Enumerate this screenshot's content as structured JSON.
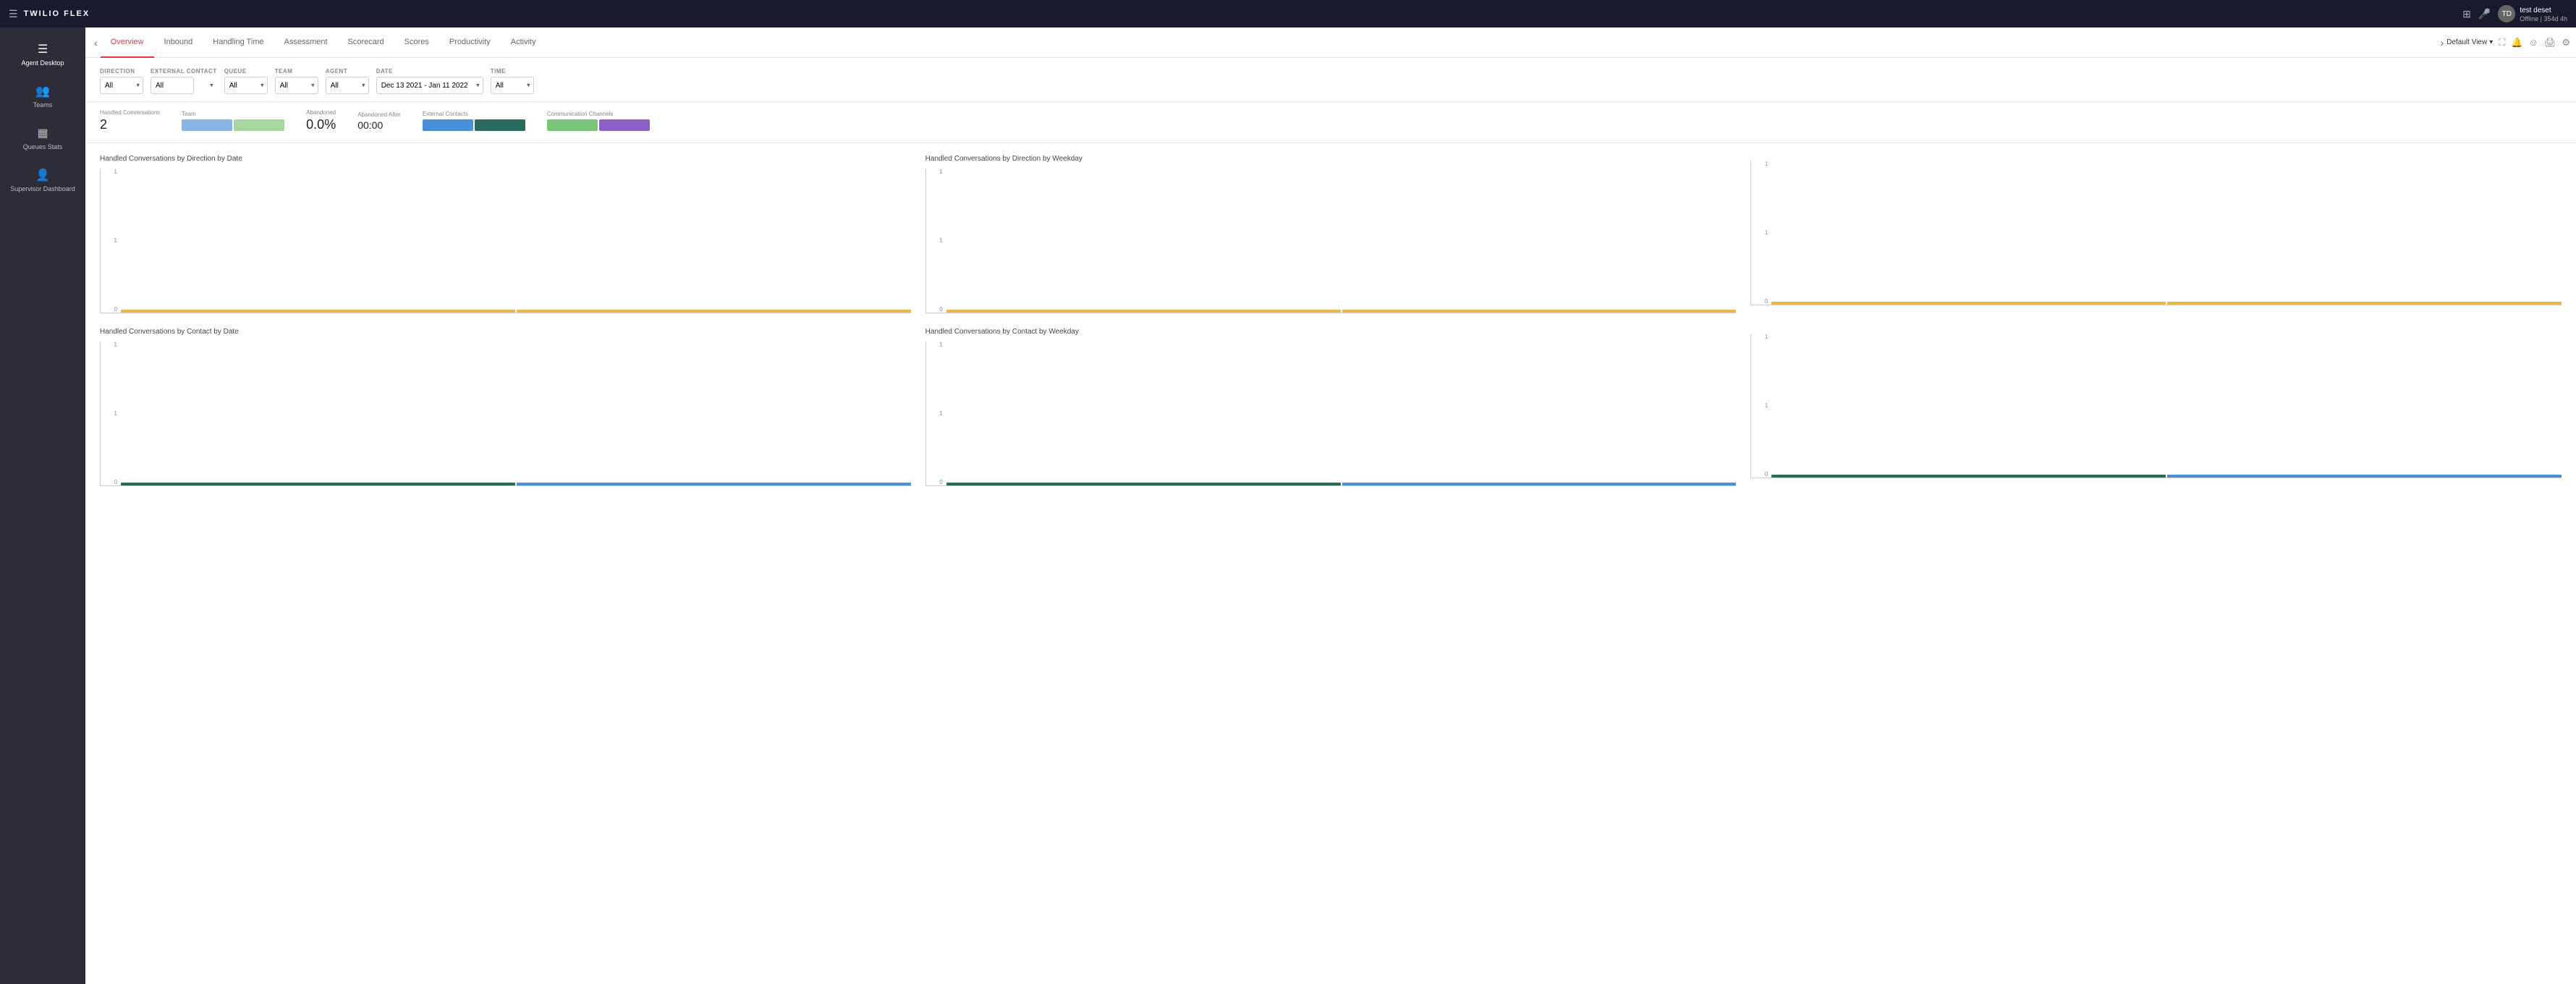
{
  "topbar": {
    "logo": "TWILIO FLEX",
    "icons": [
      "grid-icon",
      "mic-icon"
    ],
    "user": {
      "name": "test deset",
      "status": "Offline | 354d 4h",
      "initials": "TD"
    }
  },
  "sidebar": {
    "items": [
      {
        "id": "agent-desktop",
        "label": "Agent Desktop",
        "icon": "☰"
      },
      {
        "id": "teams",
        "label": "Teams",
        "icon": "👥"
      },
      {
        "id": "queues-stats",
        "label": "Queues Stats",
        "icon": "▦"
      },
      {
        "id": "supervisor-dashboard",
        "label": "Supervisor Dashboard",
        "icon": "👤"
      }
    ],
    "active": "agent-desktop"
  },
  "tabs": {
    "items": [
      {
        "id": "overview",
        "label": "Overview",
        "active": true
      },
      {
        "id": "inbound",
        "label": "Inbound"
      },
      {
        "id": "handling-time",
        "label": "Handling Time"
      },
      {
        "id": "assessment",
        "label": "Assessment"
      },
      {
        "id": "scorecard",
        "label": "Scorecard"
      },
      {
        "id": "scores",
        "label": "Scores"
      },
      {
        "id": "productivity",
        "label": "Productivity"
      },
      {
        "id": "activity",
        "label": "Activity"
      }
    ],
    "default_view_label": "Default View"
  },
  "filters": {
    "direction": {
      "label": "DIRECTION",
      "value": "All",
      "options": [
        "All"
      ]
    },
    "external_contact": {
      "label": "EXTERNAL CONTACT",
      "value": "All",
      "options": [
        "All"
      ]
    },
    "queue": {
      "label": "QUEUE",
      "value": "All",
      "options": [
        "All"
      ]
    },
    "team": {
      "label": "TEAM",
      "value": "All",
      "options": [
        "All"
      ]
    },
    "agent": {
      "label": "AGENT",
      "value": "All",
      "options": [
        "All"
      ]
    },
    "date": {
      "label": "DATE",
      "value": "Dec 13 2021 - Jan 11 2022",
      "options": [
        "Dec 13 2021 - Jan 11 2022"
      ]
    },
    "time": {
      "label": "TIME",
      "value": "All",
      "options": [
        "All"
      ]
    }
  },
  "summary": {
    "handled_conversations_label": "Handled Conversations",
    "handled_conversations_value": "2",
    "abandoned_label": "Abandoned",
    "abandoned_value": "0.0%",
    "abandoned_after_label": "Abandoned After",
    "abandoned_after_value": "00:00",
    "team_legend": {
      "label": "Team",
      "colors": [
        "#89b4e8",
        "#a8d5a2"
      ]
    },
    "external_contacts_legend": {
      "label": "External Contacts",
      "colors": [
        "#4a90d9",
        "#2d6a5e"
      ]
    },
    "communication_channels_legend": {
      "label": "Communication Channels",
      "colors": [
        "#7bc67a",
        "#8b5fc7"
      ]
    }
  },
  "charts": {
    "row1": [
      {
        "id": "by-direction-date",
        "title": "Handled Conversations by Direction by Date",
        "y_labels": [
          "1",
          "",
          "1",
          "",
          "0"
        ],
        "bars": [
          {
            "color": "yellow",
            "height": 95
          },
          {
            "color": "yellow",
            "height": 95
          }
        ]
      },
      {
        "id": "by-direction-weekday",
        "title": "Handled Conversations by Direction by Weekday",
        "y_labels": [
          "1",
          "",
          "1",
          "",
          "0"
        ],
        "bars": [
          {
            "color": "yellow",
            "height": 95
          },
          {
            "color": "yellow",
            "height": 95
          }
        ]
      },
      {
        "id": "by-direction-weekday-2",
        "title": "",
        "y_labels": [
          "1",
          "",
          "1",
          "",
          "0"
        ],
        "bars": [
          {
            "color": "yellow",
            "height": 95
          },
          {
            "color": "yellow",
            "height": 95
          }
        ]
      }
    ],
    "row2": [
      {
        "id": "by-contact-date",
        "title": "Handled Conversations by Contact by Date",
        "y_labels": [
          "1",
          "",
          "1",
          "",
          "0"
        ],
        "bars": [
          {
            "color": "teal",
            "height": 95
          },
          {
            "color": "blue",
            "height": 95
          }
        ]
      },
      {
        "id": "by-contact-weekday",
        "title": "Handled Conversations by Contact by Weekday",
        "y_labels": [
          "1",
          "",
          "1",
          "",
          "0"
        ],
        "bars": [
          {
            "color": "teal",
            "height": 95
          },
          {
            "color": "blue",
            "height": 95
          }
        ]
      },
      {
        "id": "by-contact-weekday-2",
        "title": "",
        "y_labels": [
          "1",
          "",
          "1",
          "",
          "0"
        ],
        "bars": [
          {
            "color": "teal",
            "height": 95
          },
          {
            "color": "blue",
            "height": 95
          }
        ]
      }
    ]
  }
}
